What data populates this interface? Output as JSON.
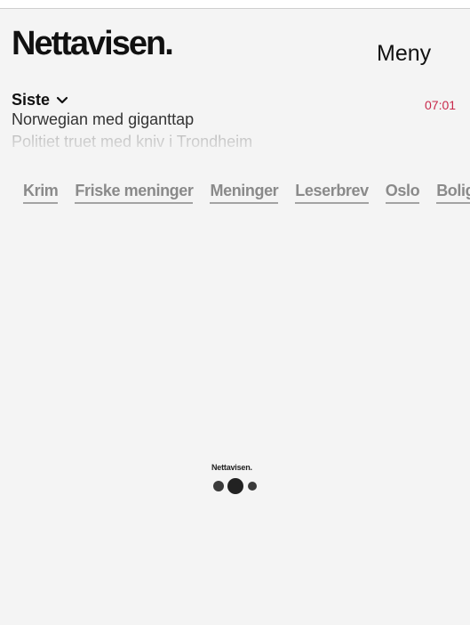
{
  "header": {
    "logo_text": "Nettavisen.",
    "menu_label": "Meny"
  },
  "latest": {
    "label": "Siste",
    "time": "07:01",
    "headlines": [
      "Norwegian med giganttap",
      "Politiet truet med kniv i Trondheim"
    ]
  },
  "nav": {
    "items": [
      "Krim",
      "Friske meninger",
      "Meninger",
      "Leserbrev",
      "Oslo",
      "Bolig"
    ]
  },
  "loader": {
    "logo_text": "Nettavisen."
  },
  "colors": {
    "background": "#f4f4f4",
    "time_accent": "#c8284a",
    "nav_text": "#8a8a8a"
  },
  "icons": {
    "latest_toggle": "chevron-down-icon",
    "loader": "loading-dots-icon"
  }
}
